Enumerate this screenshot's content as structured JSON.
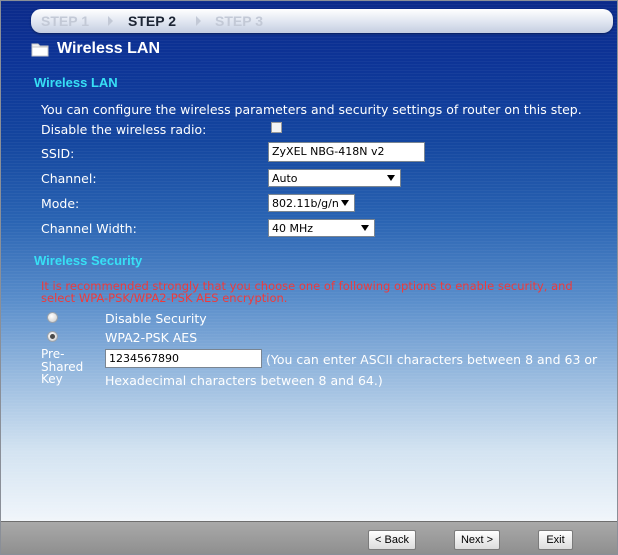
{
  "steps": {
    "step1": "STEP 1",
    "step2": "STEP 2",
    "step3": "STEP 3"
  },
  "page_title": "Wireless LAN",
  "wireless_lan": {
    "section_title": "Wireless LAN",
    "intro": "You can configure the wireless parameters and security settings of router on this step.",
    "disable_radio_label": "Disable the wireless radio:",
    "disable_radio_checked": false,
    "ssid_label": "SSID:",
    "ssid_value": "ZyXEL NBG-418N v2",
    "channel_label": "Channel:",
    "channel_value": "Auto",
    "mode_label": "Mode:",
    "mode_value": "802.11b/g/n",
    "channel_width_label": "Channel Width:",
    "channel_width_value": "40 MHz"
  },
  "wireless_security": {
    "section_title": "Wireless Security",
    "warning_line1": "It is recommended strongly that you choose one of following options to enable security, and",
    "warning_line2": "select WPA-PSK/WPA2-PSK AES encryption.",
    "option_disable": "Disable Security",
    "option_wpa2": "WPA2-PSK AES",
    "selected": "WPA2-PSK AES",
    "psk_label_1": "Pre-",
    "psk_label_2": "Shared",
    "psk_label_3": "Key",
    "psk_value": "1234567890",
    "psk_hint_1": "(You can enter ASCII characters between 8 and 63 or",
    "psk_hint_2": "Hexadecimal characters between 8 and 64.)"
  },
  "buttons": {
    "back": "< Back",
    "next": "Next >",
    "exit": "Exit"
  },
  "colors": {
    "section_title": "#37e0f5",
    "warning": "#f03a3a",
    "background_top": "#0b2a8a"
  }
}
